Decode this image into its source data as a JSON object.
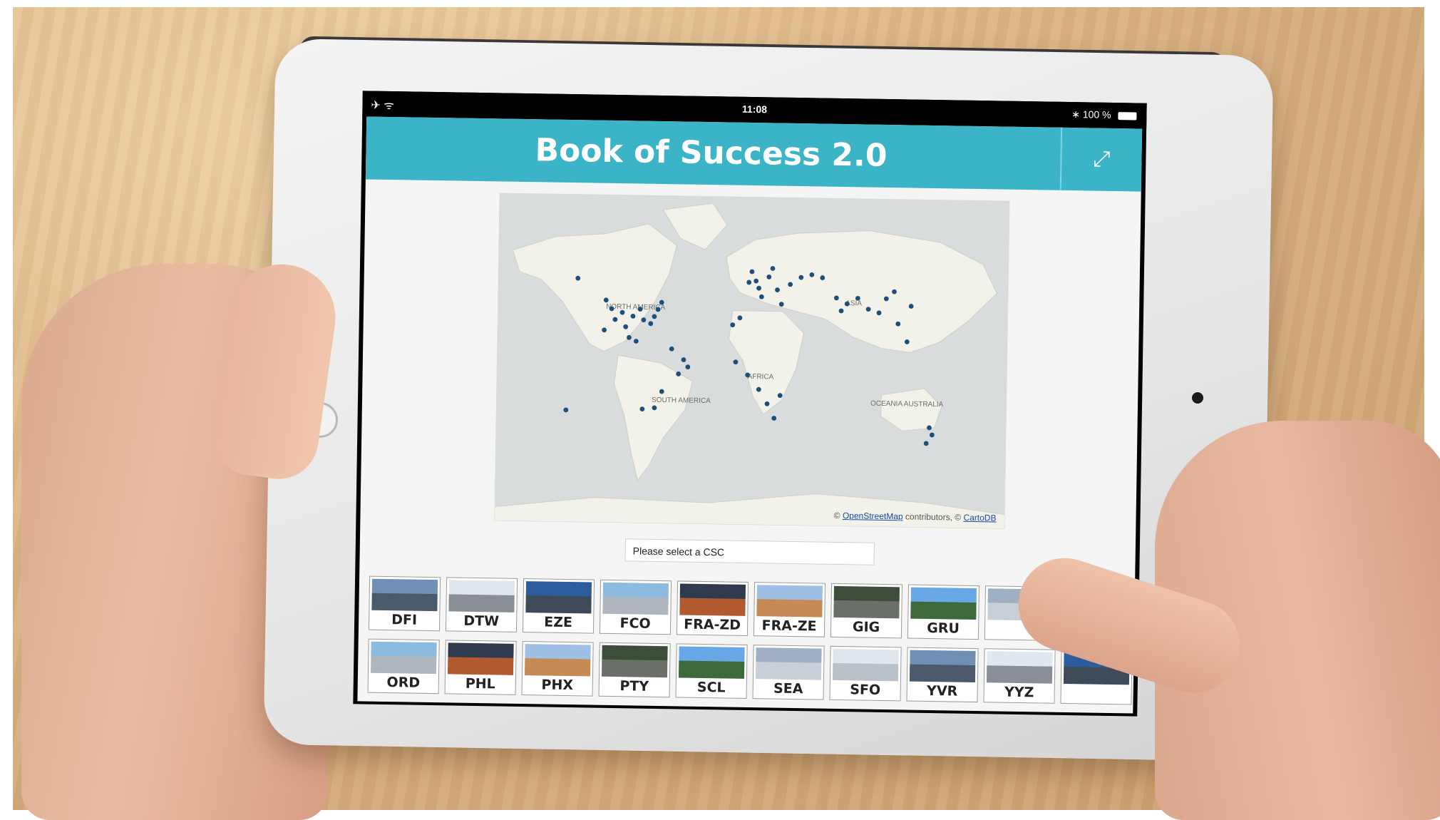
{
  "status_bar": {
    "left_icons": "✈ ᯤ",
    "time": "11:08",
    "bluetooth": "∗",
    "battery": "100 %"
  },
  "header": {
    "title": "Book of Success 2.0",
    "expand_icon": "⤢"
  },
  "map": {
    "labels": [
      "NORTH AMERICA",
      "SOUTH AMERICA",
      "AFRICA",
      "ASIA",
      "OCEANIA AUSTRALIA"
    ],
    "attribution_prefix": "©",
    "attribution_link1": "OpenStreetMap",
    "attribution_middle": "contributors, ©",
    "attribution_link2": "CartoDB"
  },
  "select": {
    "placeholder": "Please select a CSC"
  },
  "tiles": {
    "row1": [
      "DFI",
      "DTW",
      "EZE",
      "FCO",
      "FRA-ZD",
      "FRA-ZE",
      "GIG",
      "GRU",
      "",
      ""
    ],
    "row2": [
      "ORD",
      "PHL",
      "PHX",
      "PTY",
      "SCL",
      "SEA",
      "SFO",
      "YVR",
      "YYZ",
      ""
    ]
  },
  "colors": {
    "header": "#3cb4c8",
    "map_marker": "#1d4f7a",
    "map_land": "#f2f1ea",
    "map_water": "#d9dcdc"
  }
}
